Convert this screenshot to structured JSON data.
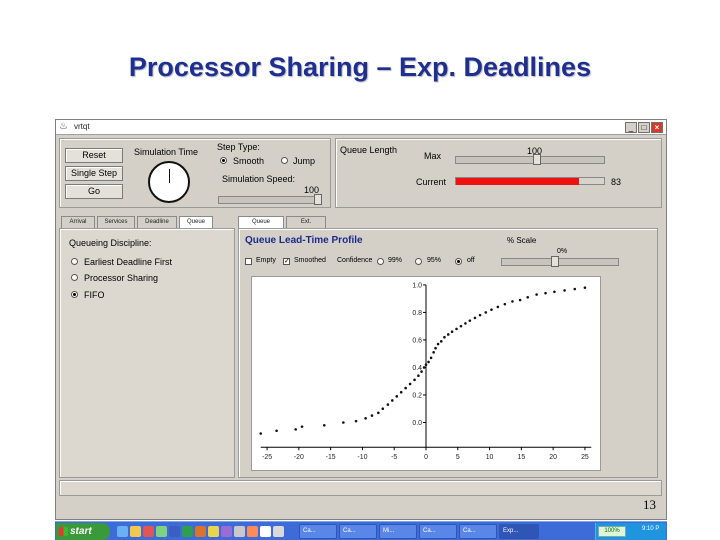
{
  "slide": {
    "title": "Processor Sharing – Exp. Deadlines",
    "page_number": "13"
  },
  "window": {
    "title": "vrtqt"
  },
  "controls": {
    "buttons": {
      "reset": "Reset",
      "single_step": "Single Step",
      "go": "Go"
    },
    "simulation_time_label": "Simulation Time",
    "step_type": {
      "label": "Step Type:",
      "smooth": "Smooth",
      "jump": "Jump",
      "selected": "smooth"
    },
    "simulation_speed": {
      "label": "Simulation Speed:",
      "value": "100",
      "level": 1.0
    }
  },
  "queue_length": {
    "label": "Queue Length",
    "max": {
      "label": "Max",
      "value": "100",
      "level": 0.55
    },
    "current": {
      "label": "Current",
      "value": "83",
      "level": 0.83,
      "color": "#ee1111"
    }
  },
  "left_tabs": [
    "Arrival",
    "Services",
    "Deadline",
    "Queue"
  ],
  "left_tab_active": 3,
  "queueing_discipline": {
    "label": "Queueing Discipline:",
    "options": [
      "Earliest Deadline First",
      "Processor Sharing",
      "FIFO"
    ],
    "selected": 2
  },
  "right_tabs": [
    "Queue",
    "Ext."
  ],
  "right_tab_active": 0,
  "profile": {
    "title": "Queue Lead-Time Profile",
    "scale_label": "% Scale",
    "scale_value": "0%",
    "scale_level": 0.45,
    "options": {
      "empty": "Empty",
      "smoothed": "Smoothed",
      "confidence": "Confidence",
      "c99": "99%",
      "c95": "95%",
      "off": "off"
    },
    "empty_checked": false,
    "smoothed_checked": true,
    "confidence_selected": "off"
  },
  "chart_data": {
    "type": "scatter",
    "x_ticks": [
      "-25",
      "-20",
      "-15",
      "-10",
      "-5",
      "0",
      "5",
      "10",
      "15",
      "20",
      "25"
    ],
    "y_ticks": [
      "1.0",
      "0.8",
      "0.6",
      "0.4",
      "0.2",
      "0.0"
    ],
    "xlim": [
      -26,
      26
    ],
    "ylim": [
      -0.18,
      1.0
    ],
    "points": [
      [
        -26,
        -0.08
      ],
      [
        -23.5,
        -0.06
      ],
      [
        -20.5,
        -0.05
      ],
      [
        -19.5,
        -0.03
      ],
      [
        -16,
        -0.02
      ],
      [
        -13,
        0.0
      ],
      [
        -11,
        0.01
      ],
      [
        -9.5,
        0.03
      ],
      [
        -8.5,
        0.05
      ],
      [
        -7.5,
        0.07
      ],
      [
        -6.8,
        0.1
      ],
      [
        -6,
        0.13
      ],
      [
        -5.3,
        0.16
      ],
      [
        -4.6,
        0.19
      ],
      [
        -3.9,
        0.22
      ],
      [
        -3.2,
        0.25
      ],
      [
        -2.5,
        0.28
      ],
      [
        -1.8,
        0.31
      ],
      [
        -1.2,
        0.34
      ],
      [
        -0.7,
        0.37
      ],
      [
        -0.3,
        0.4
      ],
      [
        0,
        0.42
      ],
      [
        0.4,
        0.44
      ],
      [
        0.8,
        0.47
      ],
      [
        1.2,
        0.51
      ],
      [
        1.5,
        0.54
      ],
      [
        1.9,
        0.57
      ],
      [
        2.4,
        0.59
      ],
      [
        2.9,
        0.62
      ],
      [
        3.5,
        0.64
      ],
      [
        4.1,
        0.66
      ],
      [
        4.8,
        0.68
      ],
      [
        5.5,
        0.7
      ],
      [
        6.2,
        0.72
      ],
      [
        6.9,
        0.74
      ],
      [
        7.7,
        0.76
      ],
      [
        8.5,
        0.78
      ],
      [
        9.4,
        0.8
      ],
      [
        10.3,
        0.82
      ],
      [
        11.3,
        0.84
      ],
      [
        12.4,
        0.86
      ],
      [
        13.6,
        0.88
      ],
      [
        14.8,
        0.89
      ],
      [
        16,
        0.91
      ],
      [
        17.4,
        0.93
      ],
      [
        18.8,
        0.94
      ],
      [
        20.2,
        0.95
      ],
      [
        21.8,
        0.96
      ],
      [
        23.4,
        0.97
      ],
      [
        25,
        0.98
      ]
    ]
  },
  "taskbar": {
    "start_label": "start",
    "tasks": [
      "Ca...",
      "Ca...",
      "Mi...",
      "Ca...",
      "Ca...",
      "Exp..."
    ],
    "active_task": 5,
    "tray_badge": "100%",
    "tray_time": "9:10 P"
  }
}
